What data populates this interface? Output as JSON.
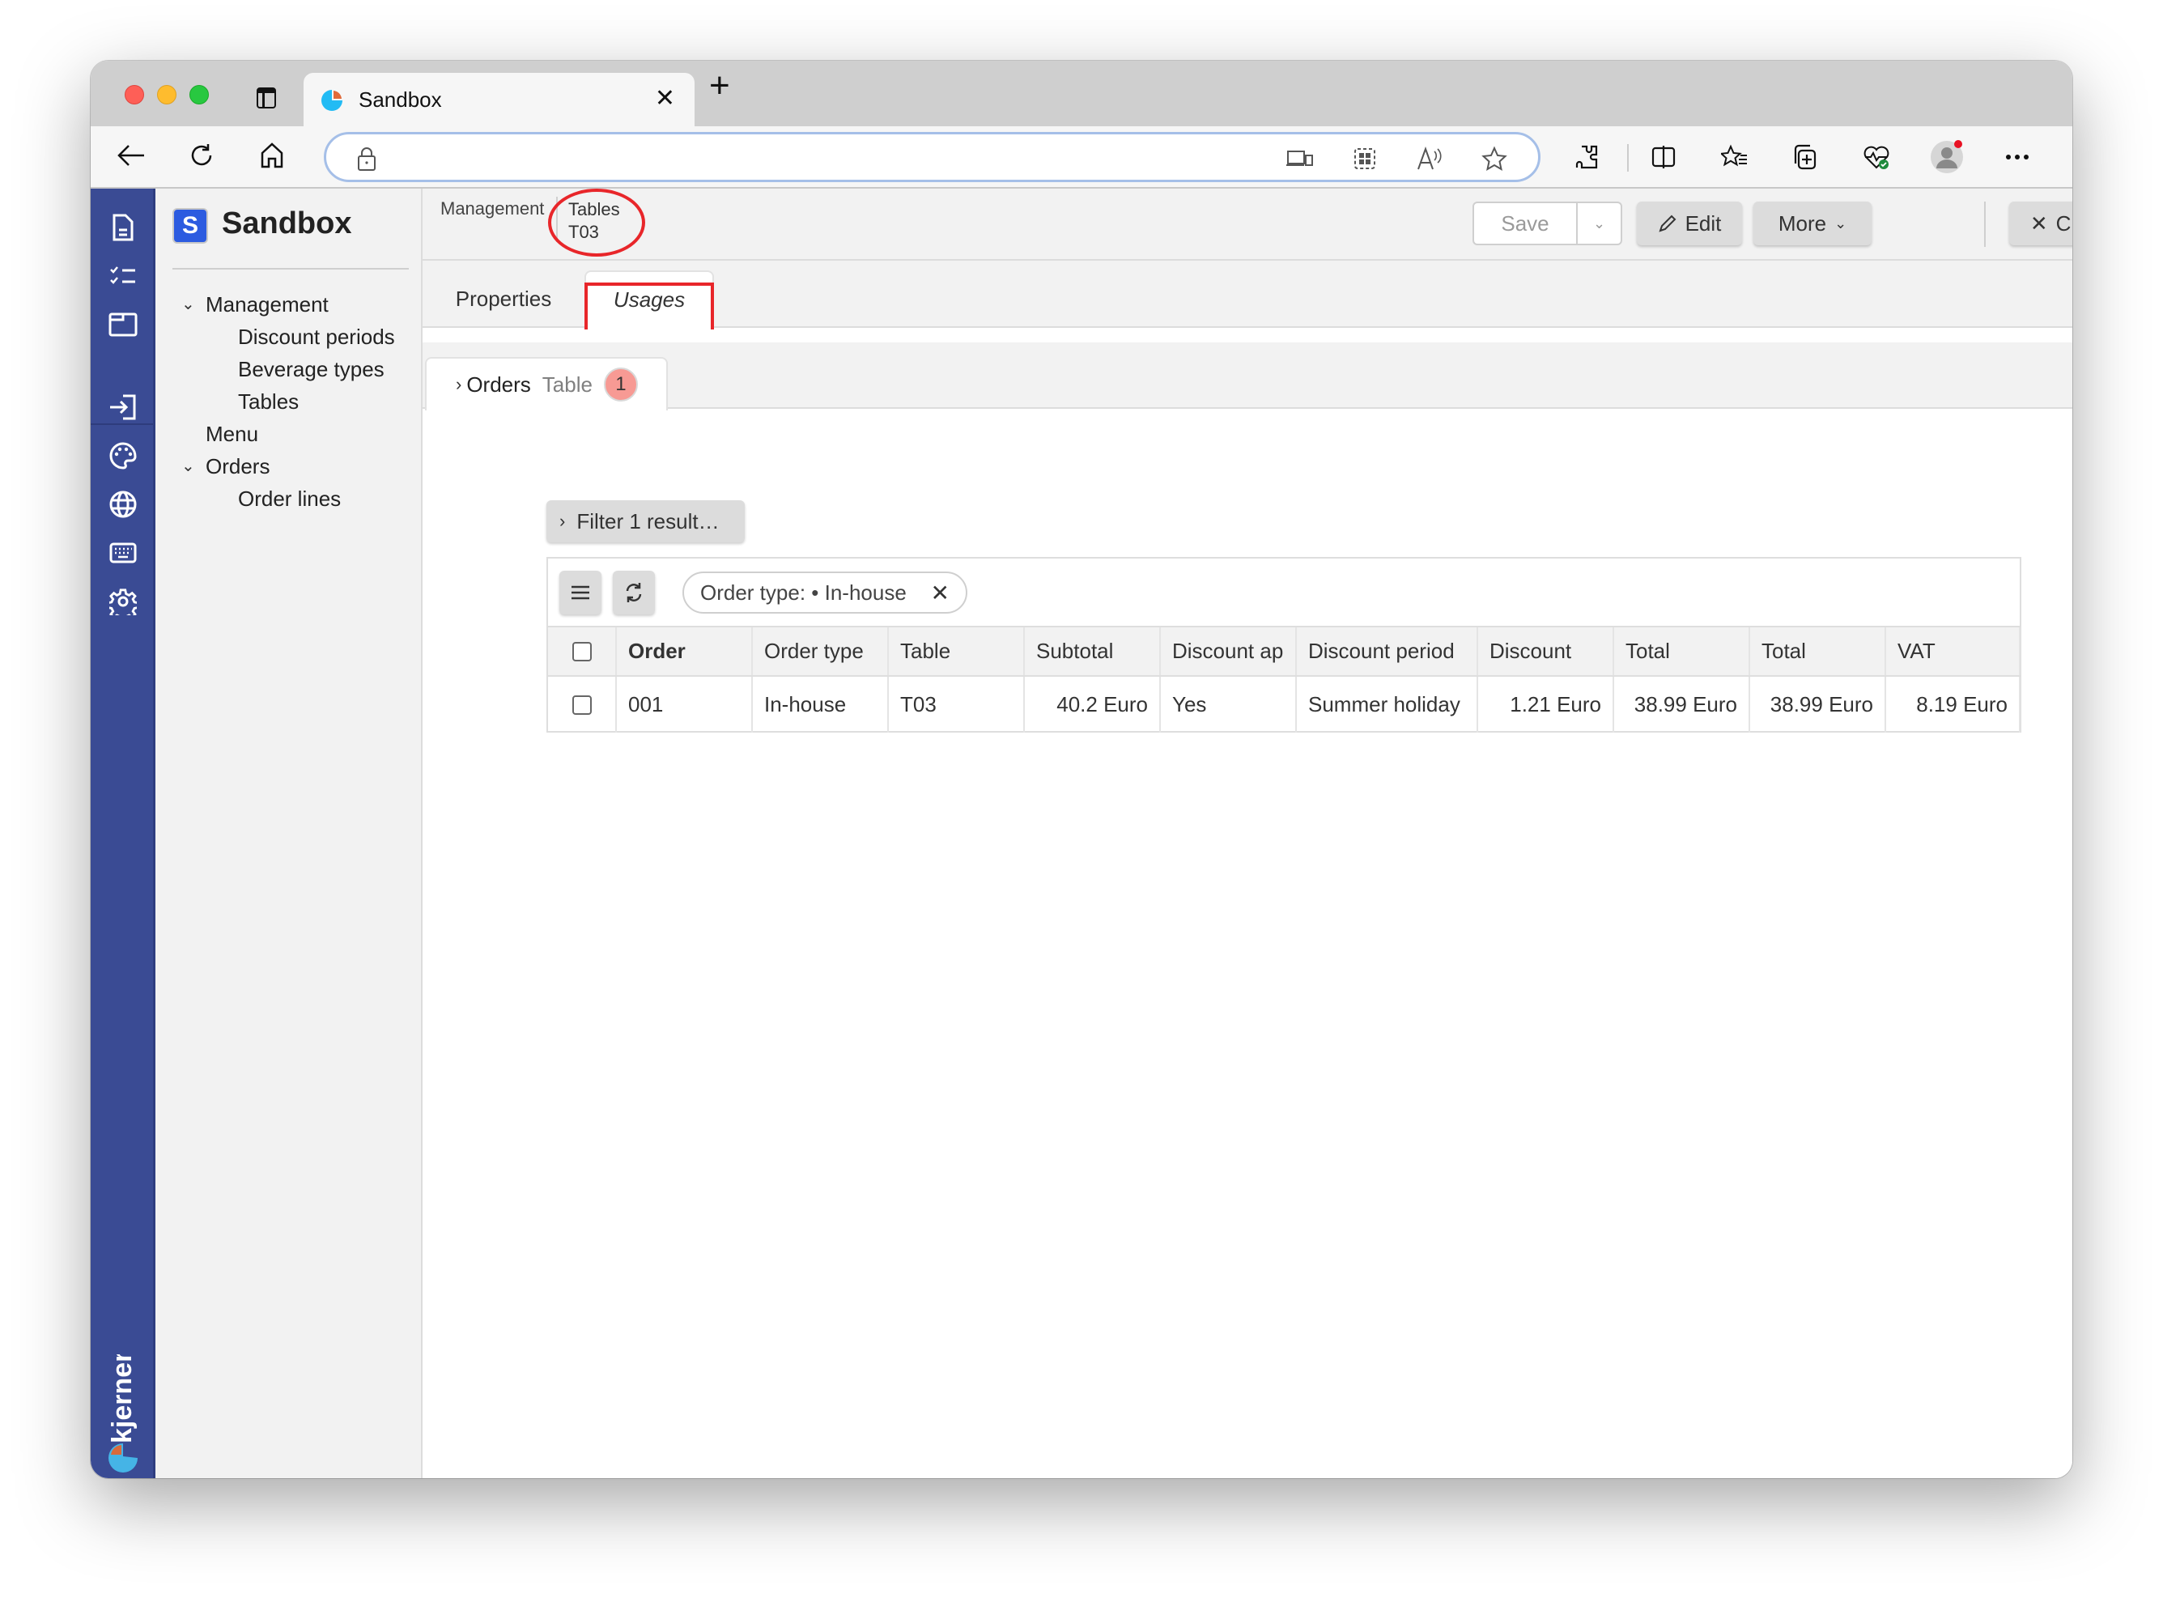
{
  "browser": {
    "tab_title": "Sandbox",
    "tab_close": "✕",
    "new_tab": "+",
    "address_url": ""
  },
  "app": {
    "logo_letter": "S",
    "name": "Sandbox",
    "brand": "kjerner",
    "colors": {
      "rail": "#3a4b94",
      "logo": "#2c5be0",
      "badge": "#f79a94",
      "annotation": "#e8262a"
    }
  },
  "rail": {
    "icons": [
      "document-icon",
      "checklist-icon",
      "window-icon",
      "login-icon",
      "palette-icon",
      "globe-icon",
      "keyboard-icon",
      "gear-icon"
    ]
  },
  "sidebar": {
    "items": [
      {
        "label": "Management",
        "expanded": true,
        "level": 0
      },
      {
        "label": "Discount periods",
        "level": 1
      },
      {
        "label": "Beverage types",
        "level": 1
      },
      {
        "label": "Tables",
        "level": 1
      },
      {
        "label": "Menu",
        "level": 0
      },
      {
        "label": "Orders",
        "expanded": true,
        "level": 0
      },
      {
        "label": "Order lines",
        "level": 1
      }
    ]
  },
  "header": {
    "breadcrumb_root": "Management",
    "entity_type": "Tables",
    "entity_name": "T03",
    "save_label": "Save",
    "edit_label": "Edit",
    "more_label": "More",
    "close_label": "Close"
  },
  "tabs": [
    {
      "label": "Properties",
      "active": false
    },
    {
      "label": "Usages",
      "active": true
    }
  ],
  "usages": {
    "tab_label": "Orders",
    "tab_sublabel": "Table",
    "count": "1",
    "filter_label": "Filter 1 result…",
    "chip_label": "Order type: • In-house",
    "columns": [
      "Order",
      "Order type",
      "Table",
      "Subtotal",
      "Discount ap",
      "Discount period",
      "Discount",
      "Total",
      "Total",
      "VAT"
    ],
    "rows": [
      [
        "001",
        "In-house",
        "T03",
        "40.2 Euro",
        "Yes",
        "Summer holiday",
        "1.21 Euro",
        "38.99 Euro",
        "38.99 Euro",
        "8.19 Euro"
      ]
    ]
  }
}
